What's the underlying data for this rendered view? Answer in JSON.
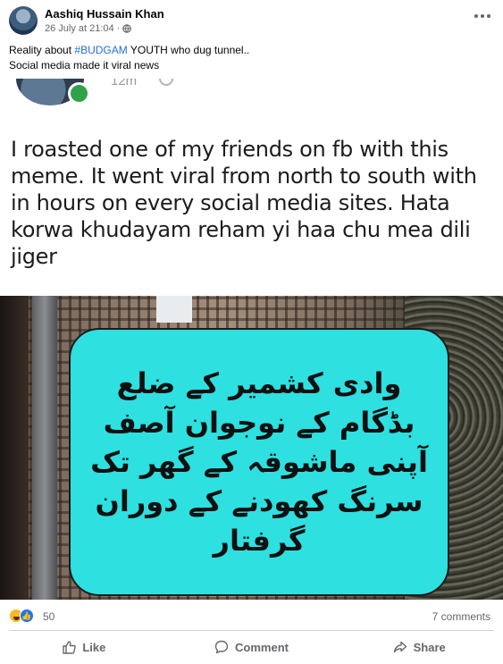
{
  "post": {
    "author": "Aashiq Hussain Khan",
    "timestamp": "26 July at 21:04",
    "caption_line1_prefix": "Reality about ",
    "caption_hashtag": "#BUDGAM",
    "caption_line1_suffix": " YOUTH who dug tunnel..",
    "caption_line2": "Social media made it viral news"
  },
  "meme": {
    "inner_time": "12m",
    "text": "I roasted one of my friends on fb with this meme. It went viral from north to south with in hours on every social media sites. Hata korwa khudayam reham yi haa chu mea dili jiger",
    "urdu_lines": [
      "وادی کشمیر کے ضلع",
      "بڈگام کے نوجوان آصف",
      "آپنی ماشوقہ کے گھر تک",
      "سرنگ کھودنے کے دوران",
      "گرفتار"
    ],
    "box_color": "#2ee0e0"
  },
  "engagement": {
    "reaction_count": "50",
    "comments": "7 comments",
    "reaction_icons": [
      "haha-icon",
      "like-icon"
    ]
  },
  "actions": {
    "like": "Like",
    "comment": "Comment",
    "share": "Share"
  },
  "colors": {
    "hashtag": "#216fdb",
    "secondary_text": "#65676b",
    "like_blue": "#1877f2"
  }
}
